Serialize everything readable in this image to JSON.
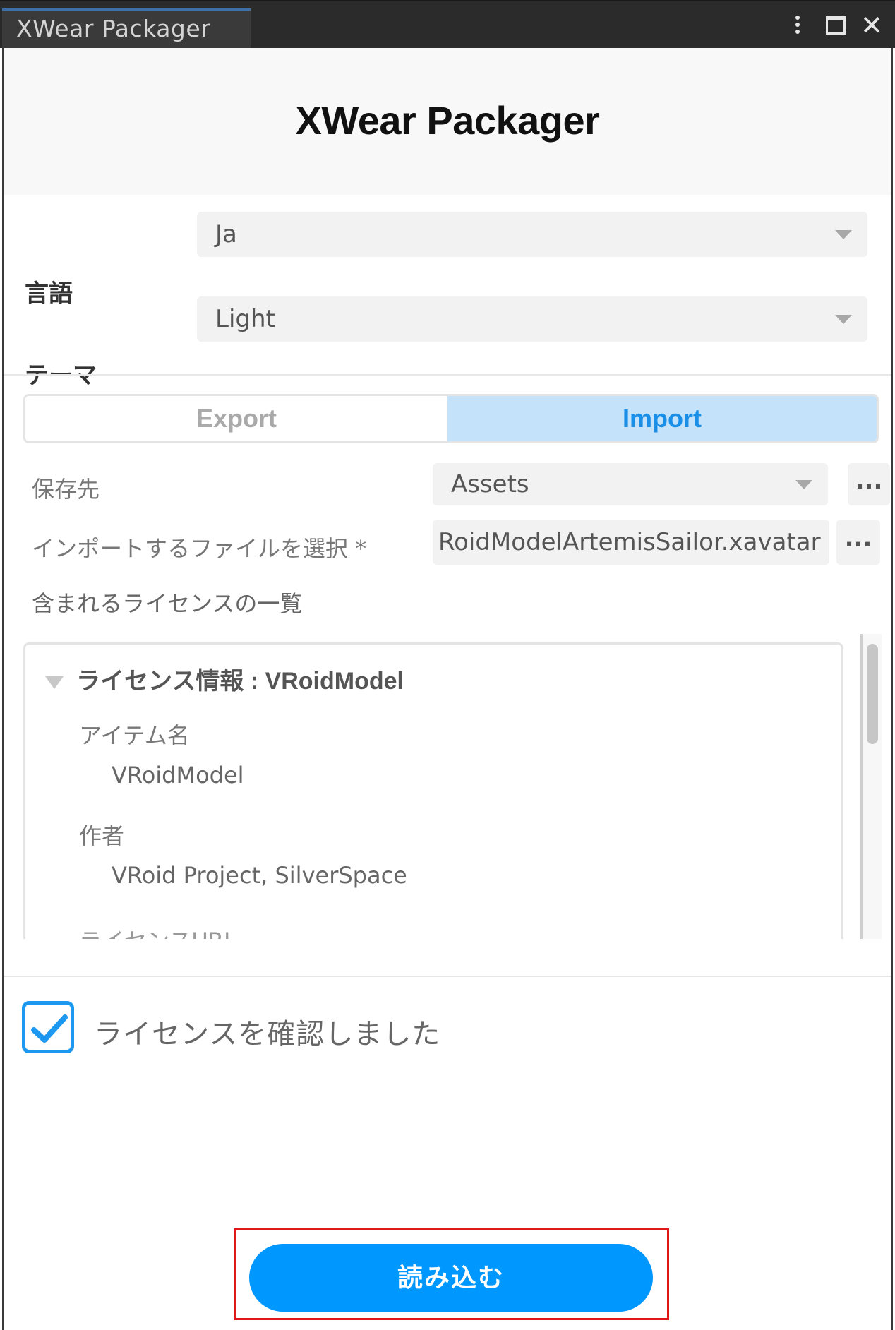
{
  "window": {
    "tab_title": "XWear Packager"
  },
  "header": {
    "title": "XWear Packager"
  },
  "settings": {
    "language_label": "言語",
    "language_value": "Ja",
    "theme_label": "テーマ",
    "theme_value": "Light"
  },
  "mode_tabs": {
    "export_label": "Export",
    "import_label": "Import",
    "selected": "Import"
  },
  "import": {
    "save_dest_label": "保存先",
    "save_dest_value": "Assets",
    "file_label": "インポートするファイルを選択 *",
    "file_value": "RoidModelArtemisSailor.xavatar",
    "browse_label": "...",
    "license_list_label": "含まれるライセンスの一覧"
  },
  "license": {
    "header": "ライセンス情報 : VRoidModel",
    "item_name_key": "アイテム名",
    "item_name_value": "VRoidModel",
    "author_key": "作者",
    "author_value": "VRoid Project, SilverSpace",
    "next_key_partial": "ライセンスURL"
  },
  "confirm": {
    "label": "ライセンスを確認しました",
    "checked": true
  },
  "actions": {
    "load_button": "読み込む"
  },
  "colors": {
    "accent": "#0097ff",
    "tab_selected_bg": "#c4e2fa",
    "highlight": "#e01818"
  }
}
